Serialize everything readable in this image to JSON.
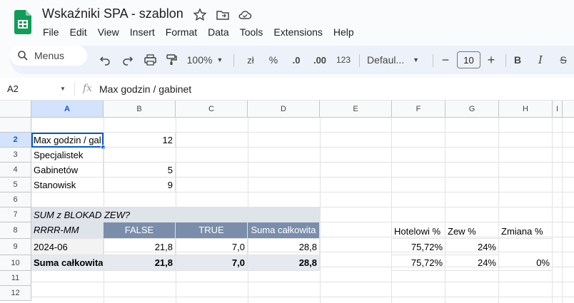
{
  "doc": {
    "title": "Wskaźniki SPA - szablon",
    "menu": [
      "File",
      "Edit",
      "View",
      "Insert",
      "Format",
      "Data",
      "Tools",
      "Extensions",
      "Help"
    ]
  },
  "toolbar": {
    "search": "Menus",
    "zoom": "100%",
    "currency": "zł",
    "percent": "%",
    "dec_dec": ".0",
    "dec_inc": ".00",
    "number_format": "123",
    "font": "Defaul...",
    "font_size": "10",
    "bold": "B",
    "italic": "I",
    "strike": "S"
  },
  "formula": {
    "cell_ref": "A2",
    "fx": "fx",
    "content": "Max godzin / gabinet"
  },
  "grid": {
    "columns": [
      "A",
      "B",
      "C",
      "D",
      "E",
      "F",
      "G",
      "H",
      "I"
    ],
    "rows": [
      "2",
      "3",
      "4",
      "5",
      "6",
      "7",
      "8",
      "9",
      "10",
      "11",
      "12"
    ],
    "a2": "Max godzin / gal",
    "b2": "12",
    "a3": "Specjalistek",
    "a4": "Gabinetów",
    "b4": "5",
    "a5": "Stanowisk",
    "b5": "9",
    "a7": "SUM z BLOKAD ZEW?",
    "a8": "RRRR-MM",
    "b8": "FALSE",
    "c8": "TRUE",
    "d8": "Suma całkowita",
    "f8": "Hotelowi %",
    "g8": "Zew %",
    "h8": "Zmiana %",
    "a9": "2024-06",
    "b9": "21,8",
    "c9": "7,0",
    "d9": "28,8",
    "f9": "75,72%",
    "g9": "24%",
    "a10": "Suma całkowita",
    "b10": "21,8",
    "c10": "7,0",
    "d10": "28,8",
    "f10": "75,72%",
    "g10": "24%",
    "h10": "0%"
  }
}
